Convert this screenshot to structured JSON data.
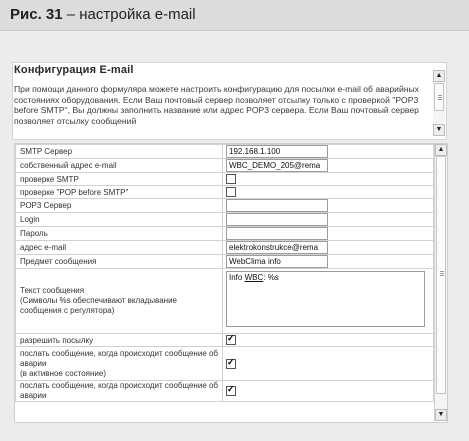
{
  "caption": {
    "number": "Рис. 31",
    "text": "– настройка e-mail"
  },
  "config": {
    "title": "Конфигурация E-mail",
    "description": "При помощи данного формуляра можете настроить конфигурацию для посылки e-mail об аварийных состояниях оборудования. Если Ваш почтовый сервер позволяет отсылку только с проверкой \"POP3 before SMTP\", Вы должны заполнить название или адрес POP3 сервера. Если Ваш почтовый сервер позволяет отсылку сообщений"
  },
  "form": {
    "rows": [
      {
        "label": "SMTP Сервер",
        "type": "text",
        "value": "192.168.1.100"
      },
      {
        "label": "собственный адрес e-mail",
        "type": "text",
        "value": "WBC_DEMO_205@rema"
      },
      {
        "label": "проверке SMTP",
        "type": "checkbox",
        "checked": false
      },
      {
        "label": "проверке \"POP before SMTP\"",
        "type": "checkbox",
        "checked": false
      },
      {
        "label": "POP3 Сервер",
        "type": "text",
        "value": ""
      },
      {
        "label": "Login",
        "type": "text",
        "value": ""
      },
      {
        "label": "Пароль",
        "type": "text",
        "value": ""
      },
      {
        "label": "адрес e-mail",
        "type": "text",
        "value": "elektrokonstrukce@rema"
      },
      {
        "label": "Предмет сообщения",
        "type": "text",
        "value": "WebClima info"
      },
      {
        "label": "Текст сообщения\n(Символы %s обеспечивают вкладывание сообщения с регулятора)",
        "type": "textarea",
        "value_prefix": "Info ",
        "value_underlined": "WBC",
        "value_suffix": ": %s"
      },
      {
        "label": "разрешить посылку",
        "type": "checkbox",
        "checked": true
      },
      {
        "label": "послать сообщение, когда происходит сообщение об аварии\n(в активное состояние)",
        "type": "checkbox",
        "checked": true
      },
      {
        "label": "послать сообщение, когда происходит сообщение об аварии",
        "type": "checkbox",
        "checked": true
      }
    ]
  },
  "scroll": {
    "up": "▲",
    "down": "▼"
  }
}
